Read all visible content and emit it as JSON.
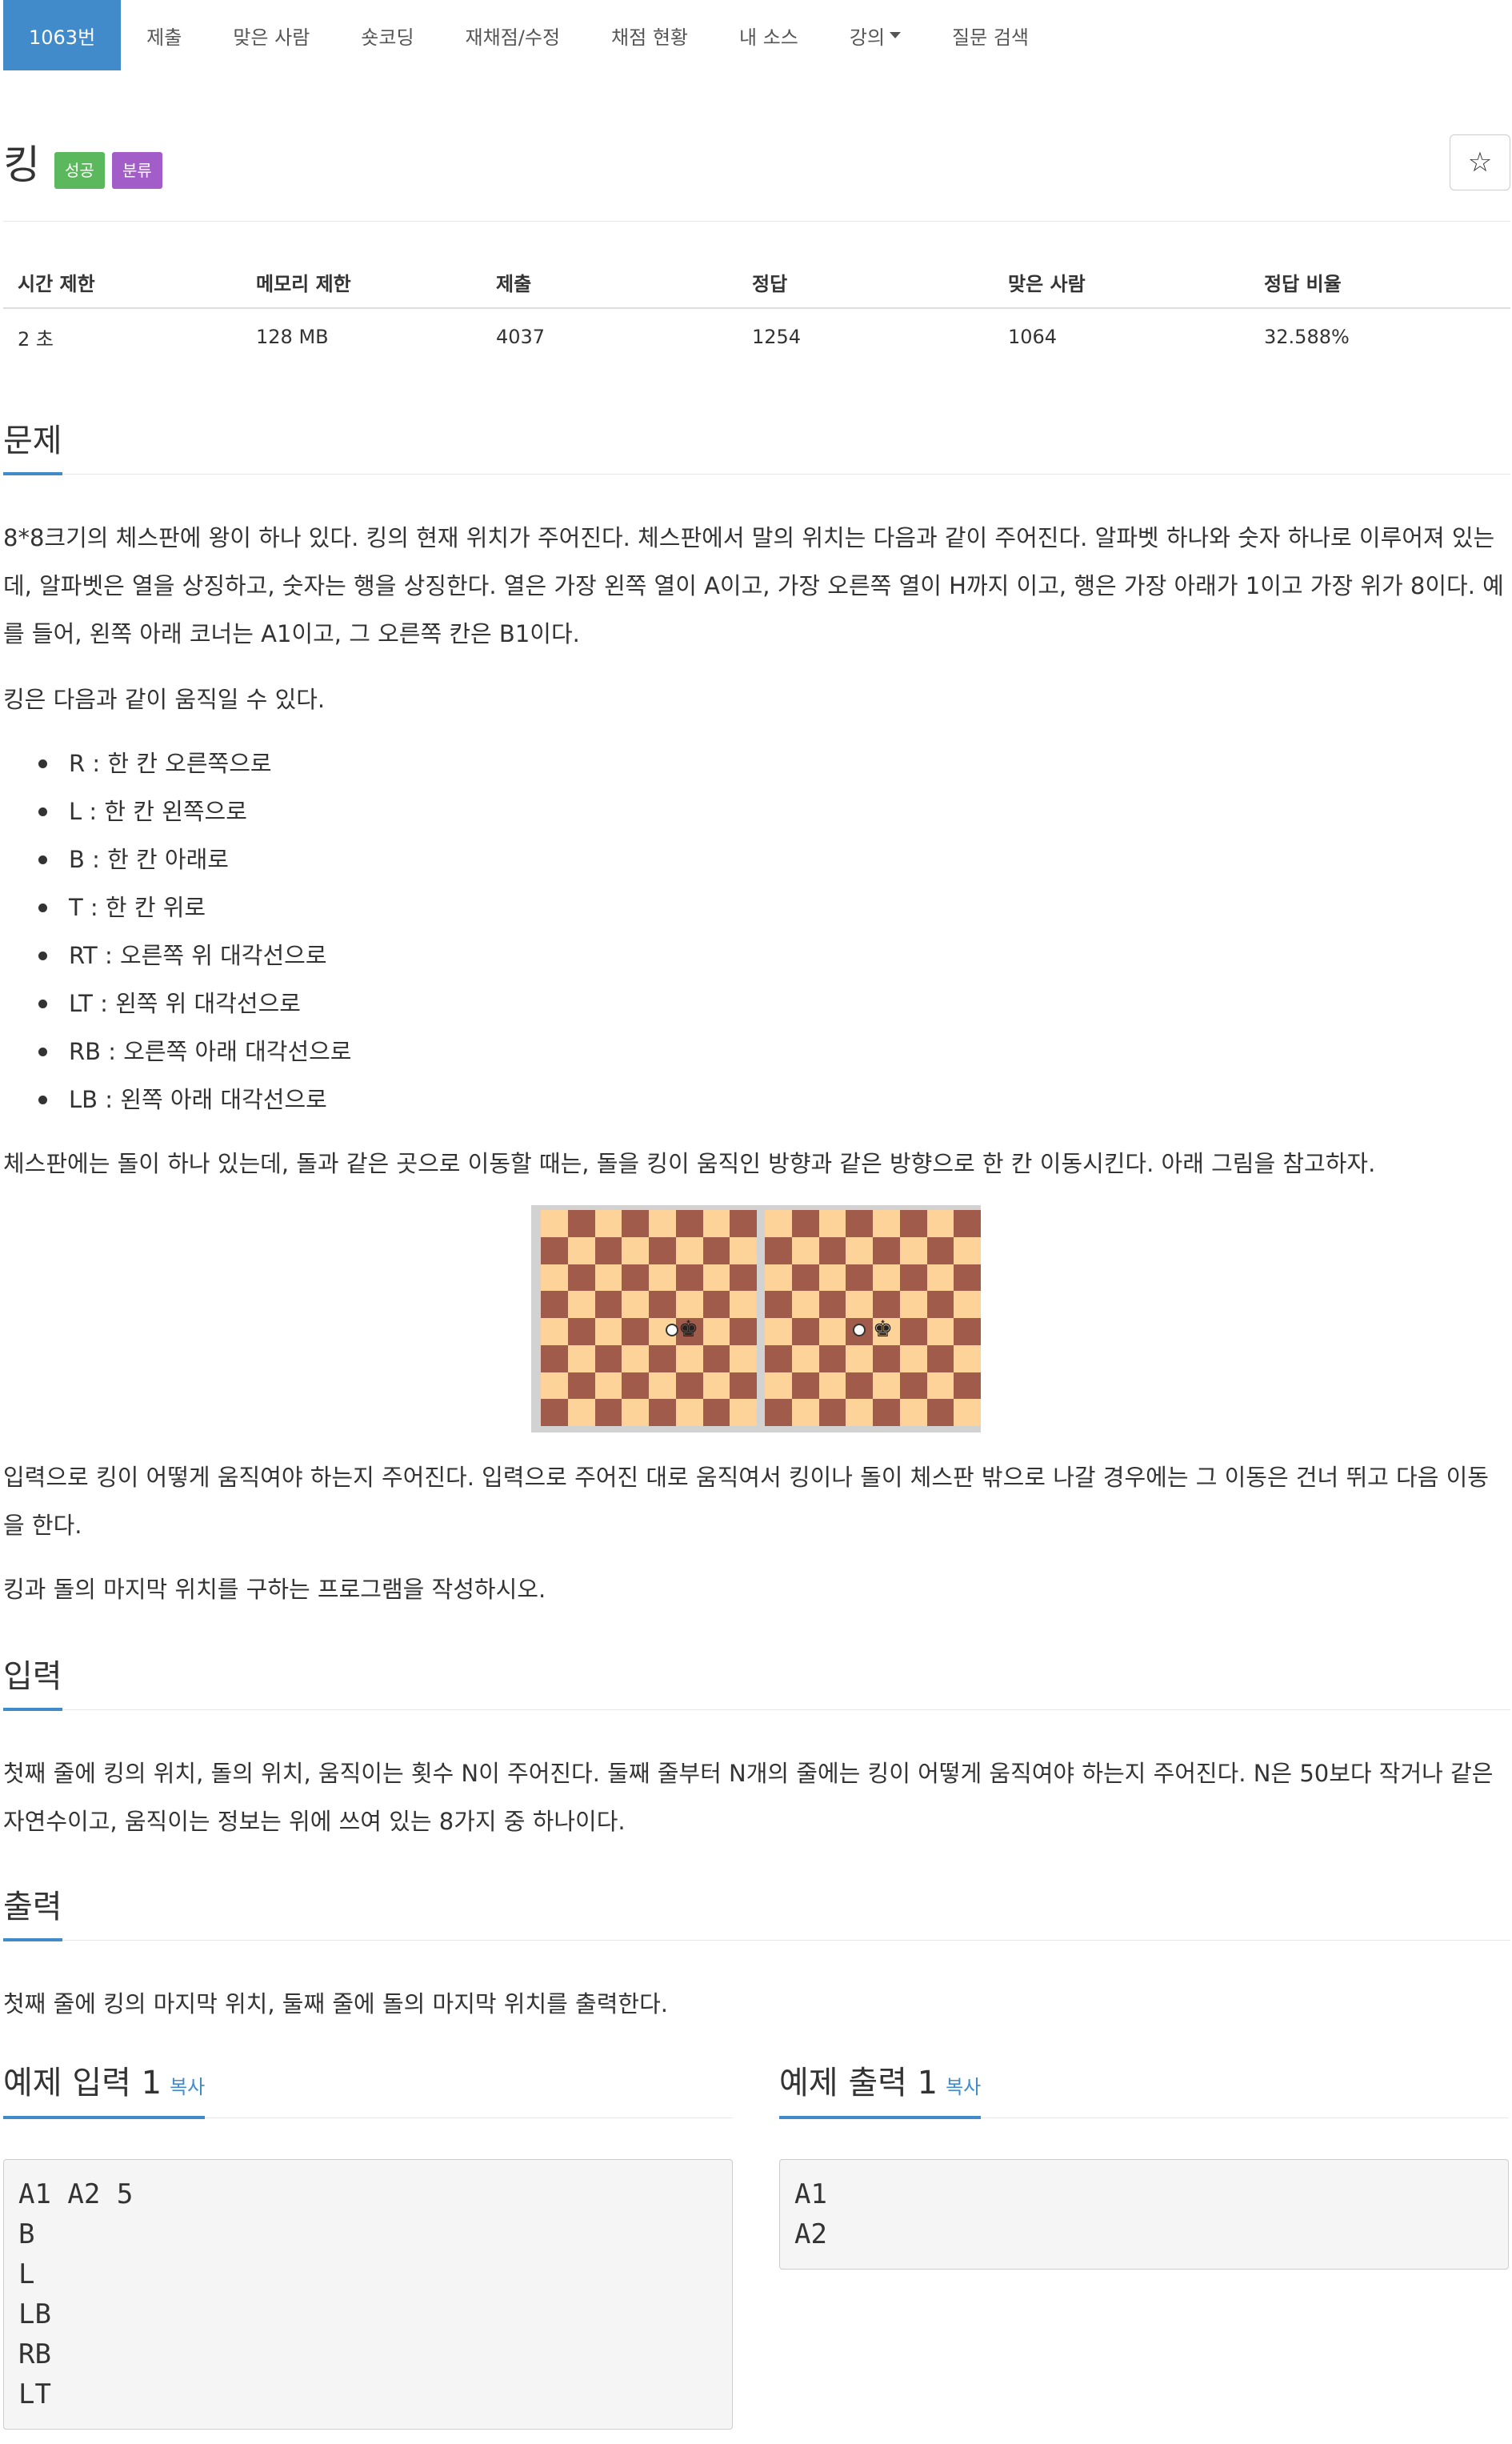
{
  "tabs": [
    {
      "label": "1063번",
      "active": true
    },
    {
      "label": "제출"
    },
    {
      "label": "맞은 사람"
    },
    {
      "label": "숏코딩"
    },
    {
      "label": "재채점/수정"
    },
    {
      "label": "채점 현황"
    },
    {
      "label": "내 소스"
    },
    {
      "label": "강의",
      "dropdown": true
    },
    {
      "label": "질문 검색"
    }
  ],
  "problem": {
    "title": "킹",
    "labels": {
      "success": "성공",
      "classify": "분류"
    },
    "star_icon": "star-icon"
  },
  "info": {
    "headers": [
      "시간 제한",
      "메모리 제한",
      "제출",
      "정답",
      "맞은 사람",
      "정답 비율"
    ],
    "values": [
      "2 초",
      "128 MB",
      "4037",
      "1254",
      "1064",
      "32.588%"
    ]
  },
  "sections": {
    "problem_heading": "문제",
    "problem_p1": "8*8크기의 체스판에 왕이 하나 있다. 킹의 현재 위치가 주어진다. 체스판에서 말의 위치는 다음과 같이 주어진다. 알파벳 하나와 숫자 하나로 이루어져 있는데, 알파벳은 열을 상징하고, 숫자는 행을 상징한다. 열은 가장 왼쪽 열이 A이고, 가장 오른쪽 열이 H까지 이고, 행은 가장 아래가 1이고 가장 위가 8이다. 예를 들어, 왼쪽 아래 코너는 A1이고, 그 오른쪽 칸은 B1이다.",
    "problem_p2": "킹은 다음과 같이 움직일 수 있다.",
    "moves": [
      "R : 한 칸 오른쪽으로",
      "L : 한 칸 왼쪽으로",
      "B : 한 칸 아래로",
      "T : 한 칸 위로",
      "RT : 오른쪽 위 대각선으로",
      "LT : 왼쪽 위 대각선으로",
      "RB : 오른쪽 아래 대각선으로",
      "LB : 왼쪽 아래 대각선으로"
    ],
    "problem_p3": "체스판에는 돌이 하나 있는데, 돌과 같은 곳으로 이동할 때는, 돌을 킹이 움직인 방향과 같은 방향으로 한 칸 이동시킨다. 아래 그림을 참고하자.",
    "problem_p4": "입력으로 킹이 어떻게 움직여야 하는지 주어진다. 입력으로 주어진 대로 움직여서 킹이나 돌이 체스판 밖으로 나갈 경우에는 그 이동은 건너 뛰고 다음 이동을 한다.",
    "problem_p5": "킹과 돌의 마지막 위치를 구하는 프로그램을 작성하시오.",
    "input_heading": "입력",
    "input_p": "첫째 줄에 킹의 위치, 돌의 위치, 움직이는 횟수 N이 주어진다. 둘째 줄부터 N개의 줄에는 킹이 어떻게 움직여야 하는지 주어진다. N은 50보다 작거나 같은 자연수이고, 움직이는 정보는 위에 쓰여 있는 8가지 중 하나이다.",
    "output_heading": "출력",
    "output_p": "첫째 줄에 킹의 마지막 위치, 둘째 줄에 돌의 마지막 위치를 출력한다."
  },
  "figure": {
    "light_color": "#fdd39a",
    "dark_color": "#a05b4a",
    "king_icon": "♚",
    "stone_icon": "stone-icon"
  },
  "examples": {
    "input_title": "예제 입력 1",
    "output_title": "예제 출력 1",
    "copy_label": "복사",
    "input_text": "A1 A2 5\nB\nL\nLB\nRB\nLT",
    "output_text": "A1\nA2"
  },
  "colors": {
    "accent": "#428bca",
    "success": "#5cb85c",
    "classify": "#a35dc9"
  }
}
